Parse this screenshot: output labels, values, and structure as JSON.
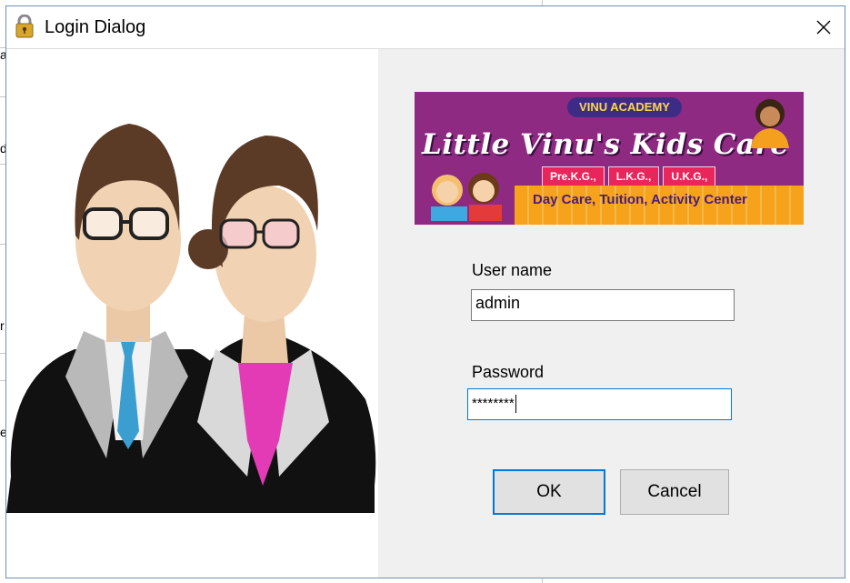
{
  "window": {
    "title": "Login Dialog"
  },
  "icons": {
    "title": "lock-icon",
    "close": "close-icon"
  },
  "background_app": {
    "visible_chars": [
      "a",
      "d",
      "r",
      "e"
    ]
  },
  "banner": {
    "tag": "VINU ACADEMY",
    "headline": "Little Vinu's Kids Care",
    "classes": [
      "Pre.K.G.,",
      "L.K.G.,",
      "U.K.G.,"
    ],
    "services": "Day Care,  Tuition,  Activity Center"
  },
  "form": {
    "username_label": "User name",
    "username_value": "admin",
    "password_label": "Password",
    "password_value": "********"
  },
  "buttons": {
    "ok": "OK",
    "cancel": "Cancel"
  },
  "colors": {
    "accent": "#0078d7",
    "dialog_bg": "#f0f0f0",
    "banner_bg": "#8e2a82"
  }
}
